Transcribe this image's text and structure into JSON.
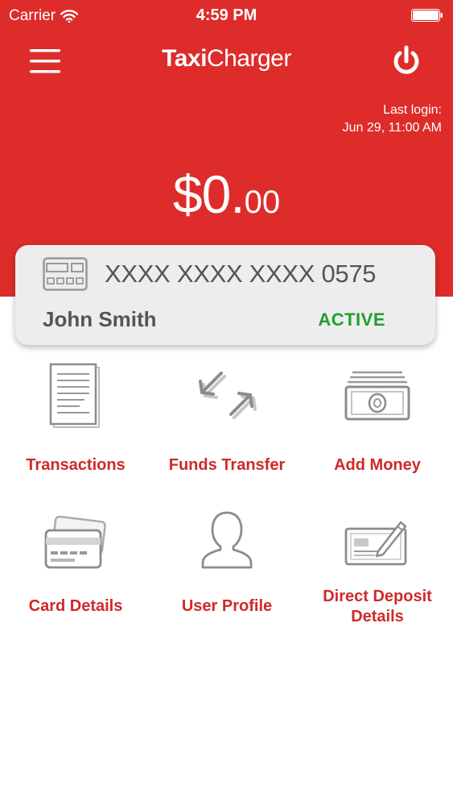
{
  "status_bar": {
    "carrier": "Carrier",
    "time": "4:59 PM"
  },
  "app": {
    "brand_part1": "Taxi",
    "brand_part2": "Charger"
  },
  "session": {
    "last_login_label": "Last login:",
    "last_login_time": "Jun 29, 11:00 AM"
  },
  "balance": {
    "dollars": "$0.",
    "cents": "00"
  },
  "card": {
    "number": "XXXX XXXX XXXX 0575",
    "holder": "John Smith",
    "status": "ACTIVE"
  },
  "menu": {
    "transactions": "Transactions",
    "funds_transfer": "Funds Transfer",
    "add_money": "Add Money",
    "card_details": "Card Details",
    "user_profile": "User Profile",
    "direct_deposit_line1": "Direct Deposit",
    "direct_deposit_line2": "Details"
  },
  "colors": {
    "brand_red": "#dd2c2a",
    "label_red": "#cf2a2a",
    "status_green": "#1f9e2f",
    "icon_gray": "#8c8c8c"
  }
}
